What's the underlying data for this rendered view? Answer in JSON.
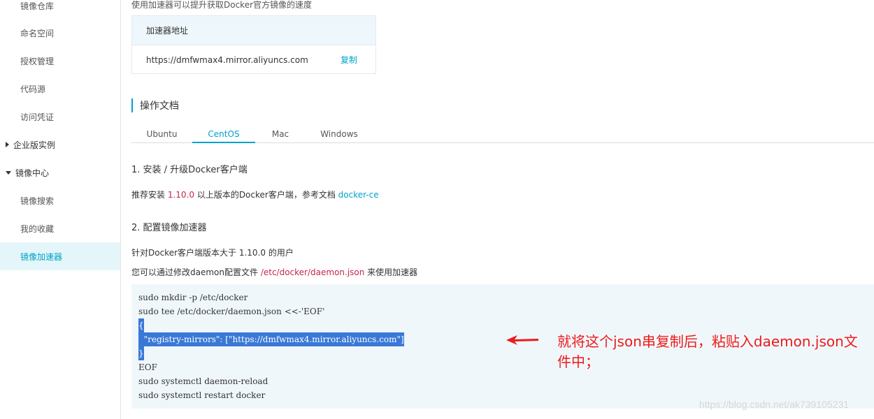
{
  "sidebar": {
    "items": [
      {
        "label": "镜像仓库",
        "type": "sub"
      },
      {
        "label": "命名空间",
        "type": "sub"
      },
      {
        "label": "授权管理",
        "type": "sub"
      },
      {
        "label": "代码源",
        "type": "sub"
      },
      {
        "label": "访问凭证",
        "type": "sub"
      },
      {
        "label": "企业版实例",
        "type": "group-collapsed"
      },
      {
        "label": "镜像中心",
        "type": "group-expanded"
      },
      {
        "label": "镜像搜索",
        "type": "sub"
      },
      {
        "label": "我的收藏",
        "type": "sub"
      },
      {
        "label": "镜像加速器",
        "type": "sub",
        "active": true
      }
    ]
  },
  "main": {
    "intro": "使用加速器可以提升获取Docker官方镜像的速度",
    "accelerator": {
      "header": "加速器地址",
      "url": "https://dmfwmax4.mirror.aliyuncs.com",
      "copy_label": "复制"
    },
    "section_title": "操作文档",
    "tabs": [
      {
        "label": "Ubuntu"
      },
      {
        "label": "CentOS",
        "active": true
      },
      {
        "label": "Mac"
      },
      {
        "label": "Windows"
      }
    ],
    "step1": {
      "title": "1. 安装 / 升级Docker客户端",
      "text_a": "推荐安装 ",
      "version": "1.10.0",
      "text_b": " 以上版本的Docker客户端，参考文档 ",
      "link": "docker-ce"
    },
    "step2": {
      "title": "2. 配置镜像加速器",
      "line1": "针对Docker客户端版本大于 1.10.0 的用户",
      "line2_a": "您可以通过修改daemon配置文件 ",
      "path": "/etc/docker/daemon.json",
      "line2_b": " 来使用加速器"
    },
    "code_lines": [
      "sudo mkdir -p /etc/docker",
      "sudo tee /etc/docker/daemon.json <<-'EOF'",
      "{",
      "  \"registry-mirrors\": [\"https://dmfwmax4.mirror.aliyuncs.com\"]",
      "}",
      "EOF",
      "sudo systemctl daemon-reload",
      "sudo systemctl restart docker"
    ]
  },
  "annotation": {
    "note_line1": "就将这个json串复制后，粘贴入daemon.json文",
    "note_line2": "件中；",
    "color": "#ee1a1a"
  },
  "watermark": "https://blog.csdn.net/ak739105231",
  "colors": {
    "accent": "#00a2ca",
    "highlight": "#c7254e",
    "selection": "#3a78d6"
  }
}
